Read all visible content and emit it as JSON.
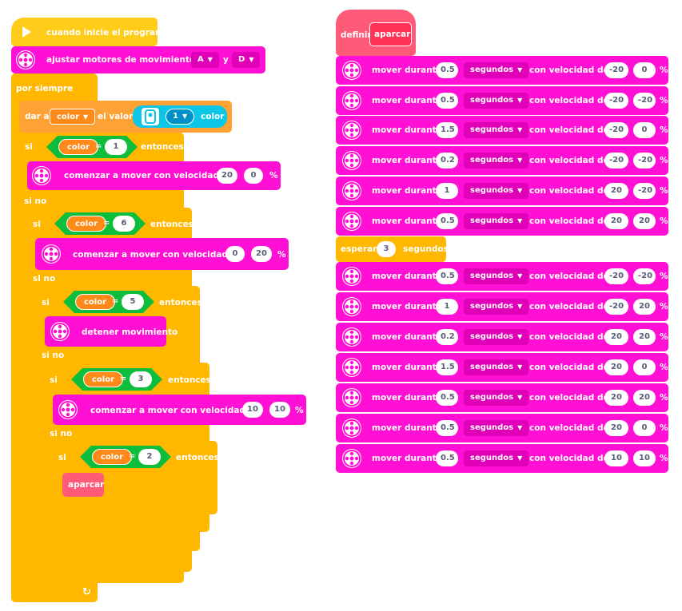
{
  "program": {
    "hat_label": "cuando inicie el programa",
    "set_motors": {
      "label": "ajustar motores de movimiento en",
      "port1": "A",
      "and": "y",
      "port2": "D"
    },
    "forever_label": "por siempre",
    "set_var": {
      "label": "dar a",
      "var": "color",
      "value_label": "el valor",
      "sensor_port": "1",
      "sensor_mode": "color"
    },
    "if1": {
      "if": "si",
      "var": "color",
      "op": "=",
      "value": "1",
      "then": "entonces"
    },
    "move1": {
      "label": "comenzar a mover con velocidad de",
      "v1": "20",
      "v2": "0",
      "unit": "%"
    },
    "else1": "si no",
    "if2": {
      "if": "si",
      "var": "color",
      "op": "=",
      "value": "6",
      "then": "entonces"
    },
    "move2": {
      "label": "comenzar a mover con velocidad de",
      "v1": "0",
      "v2": "20",
      "unit": "%"
    },
    "else2": "si no",
    "if3": {
      "if": "si",
      "var": "color",
      "op": "=",
      "value": "5",
      "then": "entonces"
    },
    "stop": {
      "label": "detener movimiento"
    },
    "else3": "si no",
    "if4": {
      "if": "si",
      "var": "color",
      "op": "=",
      "value": "3",
      "then": "entonces"
    },
    "move4": {
      "label": "comenzar a mover con velocidad de",
      "v1": "10",
      "v2": "10",
      "unit": "%"
    },
    "else4": "si no",
    "if5": {
      "if": "si",
      "var": "color",
      "op": "=",
      "value": "2",
      "then": "entonces"
    },
    "call": "aparcar",
    "loop_arrow": "↻"
  },
  "define": {
    "label": "definir",
    "name": "aparcar",
    "moves_a": [
      {
        "dur": "0.5",
        "unit": "segundos",
        "v1": "-20",
        "v2": "0"
      },
      {
        "dur": "0.5",
        "unit": "segundos",
        "v1": "-20",
        "v2": "-20"
      },
      {
        "dur": "1.5",
        "unit": "segundos",
        "v1": "-20",
        "v2": "0"
      },
      {
        "dur": "0.2",
        "unit": "segundos",
        "v1": "-20",
        "v2": "-20"
      },
      {
        "dur": "1",
        "unit": "segundos",
        "v1": "20",
        "v2": "-20"
      },
      {
        "dur": "0.5",
        "unit": "segundos",
        "v1": "20",
        "v2": "20"
      }
    ],
    "wait": {
      "label": "esperar",
      "value": "3",
      "unit": "segundos"
    },
    "moves_b": [
      {
        "dur": "0.5",
        "unit": "segundos",
        "v1": "-20",
        "v2": "-20"
      },
      {
        "dur": "1",
        "unit": "segundos",
        "v1": "-20",
        "v2": "20"
      },
      {
        "dur": "0.2",
        "unit": "segundos",
        "v1": "20",
        "v2": "20"
      },
      {
        "dur": "1.5",
        "unit": "segundos",
        "v1": "20",
        "v2": "0"
      },
      {
        "dur": "0.5",
        "unit": "segundos",
        "v1": "20",
        "v2": "20"
      },
      {
        "dur": "0.5",
        "unit": "segundos",
        "v1": "20",
        "v2": "0"
      },
      {
        "dur": "0.5",
        "unit": "segundos",
        "v1": "10",
        "v2": "10"
      }
    ],
    "move_label": "mover durante",
    "speed_label": "con velocidad de",
    "percent": "%"
  },
  "colors": {
    "motion": "#ff10d4",
    "control": "#ffb700",
    "event": "#ffcc1a",
    "variable": "#ffa235",
    "operator": "#0fbd3c",
    "sensor": "#0cc6e8",
    "myblock": "#ff5a78"
  }
}
